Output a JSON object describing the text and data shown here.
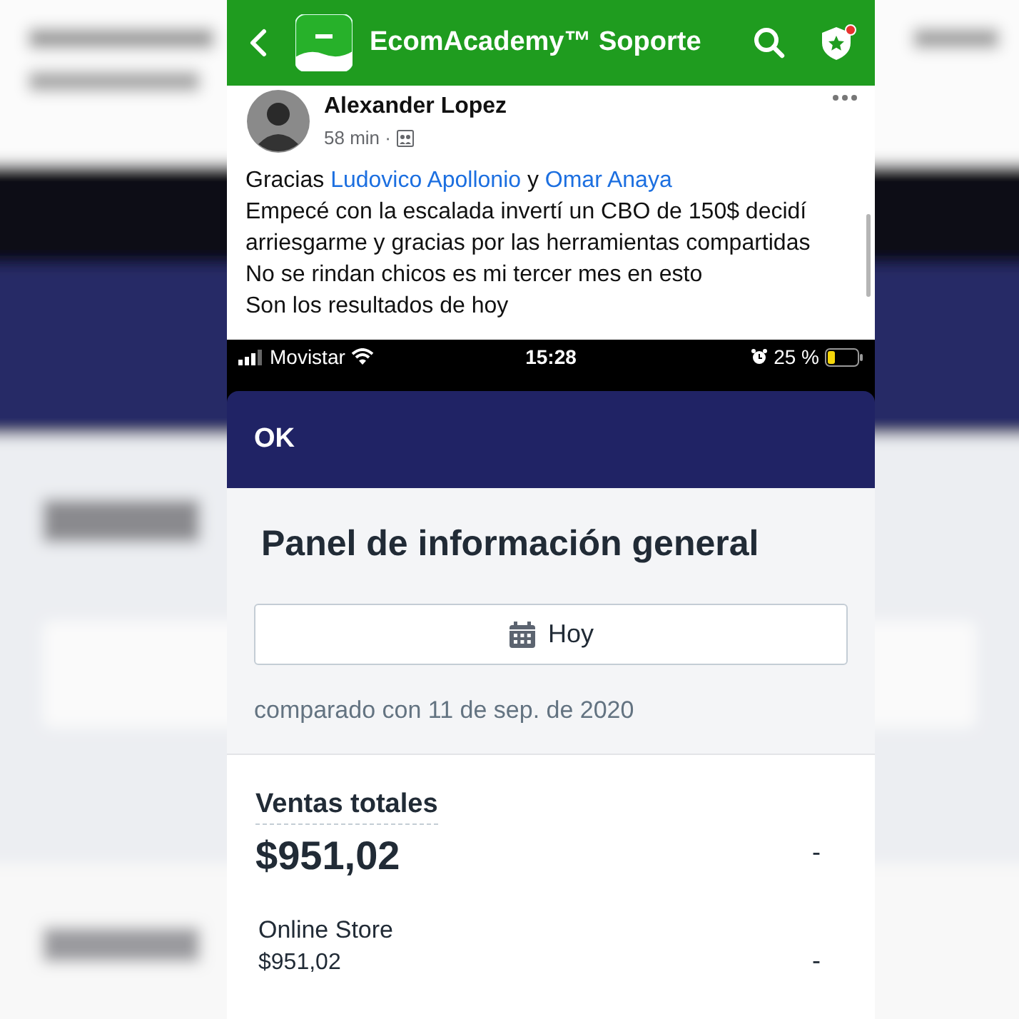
{
  "app_bar": {
    "title": "EcomAcademy™ Soporte",
    "notification_dot": true
  },
  "post": {
    "author": "Alexander Lopez",
    "time": "58 min ·",
    "lines": [
      {
        "parts": [
          {
            "kind": "plain",
            "text": "Gracias "
          },
          {
            "kind": "link",
            "text": "Ludovico Apollonio"
          },
          {
            "kind": "plain",
            "text": " y "
          },
          {
            "kind": "link",
            "text": "Omar Anaya"
          }
        ]
      },
      {
        "parts": [
          {
            "kind": "plain",
            "text": "Empecé con la escalada invertí un CBO de 150$ decidí"
          }
        ]
      },
      {
        "parts": [
          {
            "kind": "plain",
            "text": "arriesgarme y gracias por las herramientas compartidas"
          }
        ]
      },
      {
        "parts": [
          {
            "kind": "plain",
            "text": "No se rindan chicos es mi tercer mes en esto"
          }
        ]
      },
      {
        "parts": [
          {
            "kind": "plain",
            "text": "Son los resultados de hoy"
          }
        ]
      }
    ]
  },
  "screenshot": {
    "status_bar": {
      "carrier": "Movistar",
      "time": "15:28",
      "battery": "25 %"
    },
    "header": {
      "title": "OK"
    },
    "panel": {
      "title": "Panel de información general",
      "date_button": "Hoy",
      "comparison": "comparado con 11 de sep. de 2020"
    },
    "total": {
      "label": "Ventas totales",
      "value": "$951,02",
      "change": "-"
    },
    "channels": [
      {
        "name": "Online Store",
        "value": "$951,02",
        "change": "-"
      }
    ]
  }
}
